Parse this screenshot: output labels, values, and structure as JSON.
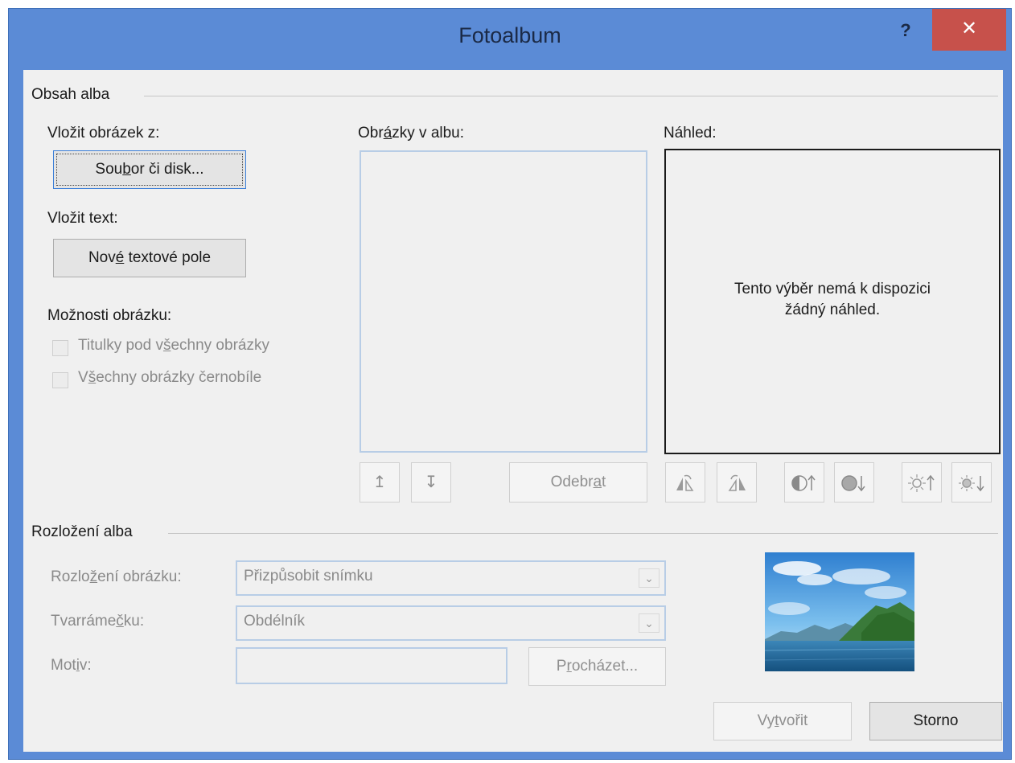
{
  "window": {
    "title": "Fotoalbum",
    "help_label": "?",
    "close_label": "✕"
  },
  "album_content": {
    "group_label": "Obsah alba",
    "insert_picture_from": "Vložit obrázek z:",
    "file_or_disk_button": {
      "before": "Sou",
      "mnemonic": "b",
      "after": "or či disk..."
    },
    "insert_text": "Vložit text:",
    "new_text_box_button": {
      "before": "Nov",
      "mnemonic": "é",
      "after": " textové pole"
    },
    "picture_options": "Možnosti obrázku:",
    "captions_checkbox": {
      "before": "Titulky pod v",
      "mnemonic": "š",
      "after": "echny obrázky",
      "checked": false
    },
    "black_white_checkbox": {
      "before": "V",
      "mnemonic": "š",
      "after": "echny obrázky černobíle",
      "checked": false
    },
    "pictures_in_album": {
      "before": "Obr",
      "mnemonic": "á",
      "after": "zky v albu:"
    },
    "preview_label": "Náhled:",
    "preview_empty_line1": "Tento výběr nemá k dispozici",
    "preview_empty_line2": "žádný náhled.",
    "remove_button": {
      "before": "Odebr",
      "mnemonic": "a",
      "after": "t"
    },
    "move_up_icon": "↥",
    "move_down_icon": "↧"
  },
  "album_layout": {
    "group_label": "Rozložení alba",
    "picture_layout_label": {
      "before": "Rozlo",
      "mnemonic": "ž",
      "after": "ení obrázku:"
    },
    "picture_layout_value": "Přizpůsobit snímku",
    "frame_shape_label": {
      "before": "Tvarráme",
      "mnemonic": "č",
      "after": "ku:"
    },
    "frame_shape_value": "Obdélník",
    "theme_label": {
      "before": "Mot",
      "mnemonic": "i",
      "after": "v:"
    },
    "theme_value": "",
    "browse_button": {
      "before": "P",
      "mnemonic": "r",
      "after": "ocházet..."
    }
  },
  "footer": {
    "create_button": {
      "before": "Vy",
      "mnemonic": "t",
      "after": "vořit"
    },
    "cancel_button": "Storno"
  },
  "colors": {
    "title_bar": "#5b8bd6",
    "close_button": "#c7514b",
    "client_background": "#f0f0f0"
  }
}
